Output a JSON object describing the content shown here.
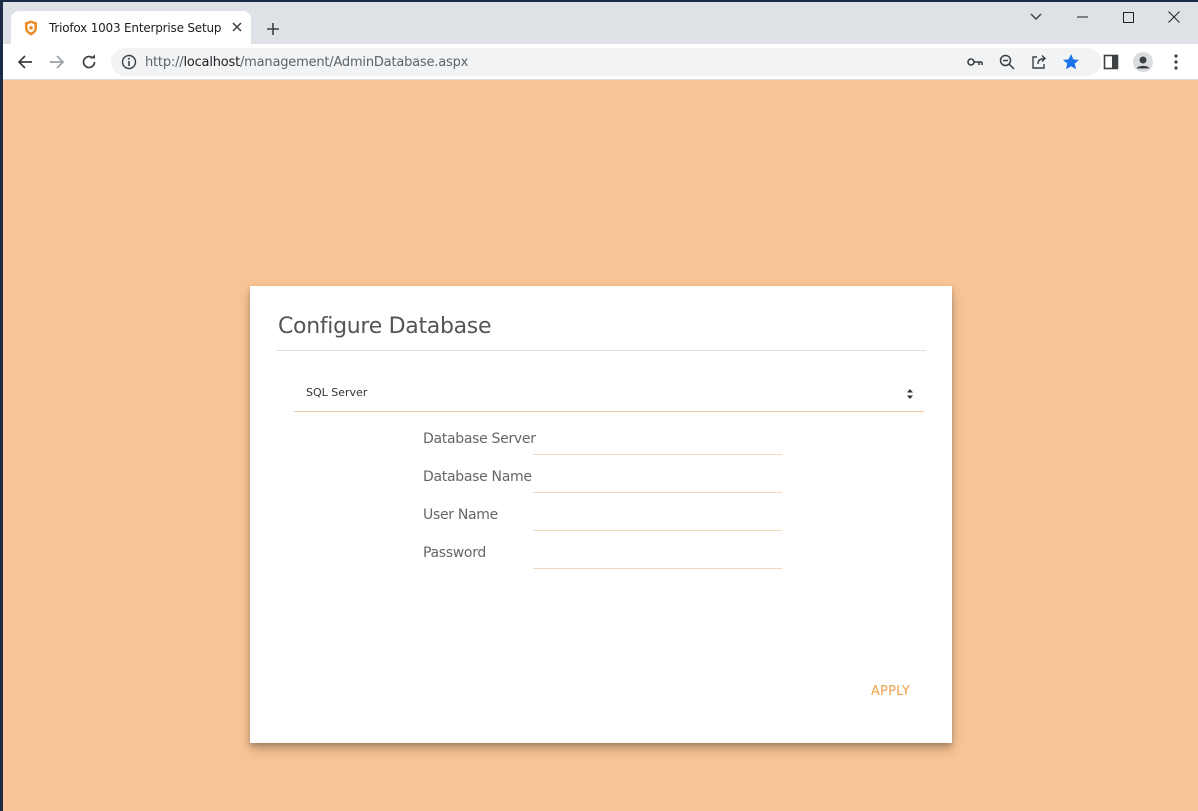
{
  "browser": {
    "tab_title": "Triofox 1003 Enterprise Setup",
    "url_prefix": "http://",
    "url_host": "localhost",
    "url_path": "/management/AdminDatabase.aspx",
    "accent_color": "#1a73e8"
  },
  "page": {
    "background_color": "#f8c495",
    "title": "Configure Database",
    "db_type_selected": "SQL Server",
    "fields": {
      "server_label": "Database Server",
      "server_value": "",
      "name_label": "Database Name",
      "name_value": "",
      "user_label": "User Name",
      "user_value": "",
      "password_label": "Password",
      "password_value": ""
    },
    "apply_label": "APPLY",
    "apply_color": "#f0a24c"
  }
}
